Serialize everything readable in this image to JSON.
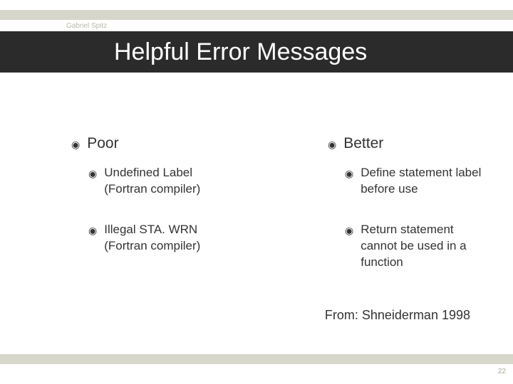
{
  "author": "Gabriel Spitz",
  "title": "Helpful Error Messages",
  "bulletGlyph": "◉",
  "columns": {
    "left": {
      "heading": "Poor",
      "items": [
        "Undefined Label (Fortran compiler)",
        "Illegal STA. WRN (Fortran compiler)"
      ]
    },
    "right": {
      "heading": "Better",
      "items": [
        "Define statement label before use",
        "Return statement cannot be used in a function"
      ]
    }
  },
  "citation": "From: Shneiderman 1998",
  "pageNumber": "22"
}
